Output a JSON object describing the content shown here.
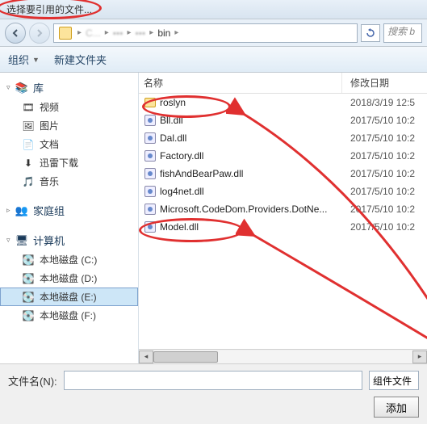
{
  "window": {
    "title": "选择要引用的文件..."
  },
  "breadcrumb": {
    "items": [
      "C...",
      "",
      "",
      "bin"
    ],
    "current": "bin"
  },
  "search": {
    "placeholder": "搜索 b"
  },
  "toolbar": {
    "organize": "组织",
    "newfolder": "新建文件夹"
  },
  "sidebar": {
    "library": {
      "label": "库",
      "items": [
        {
          "label": "视频",
          "icon": "video"
        },
        {
          "label": "图片",
          "icon": "picture"
        },
        {
          "label": "文档",
          "icon": "document"
        },
        {
          "label": "迅雷下载",
          "icon": "download"
        },
        {
          "label": "音乐",
          "icon": "music"
        }
      ]
    },
    "homegroup": {
      "label": "家庭组"
    },
    "computer": {
      "label": "计算机",
      "items": [
        {
          "label": "本地磁盘 (C:)"
        },
        {
          "label": "本地磁盘 (D:)"
        },
        {
          "label": "本地磁盘 (E:)",
          "selected": true
        },
        {
          "label": "本地磁盘 (F:)"
        }
      ]
    }
  },
  "columns": {
    "name": "名称",
    "date": "修改日期"
  },
  "files": [
    {
      "name": "roslyn",
      "type": "folder",
      "date": "2018/3/19 12:5"
    },
    {
      "name": "Bll.dll",
      "type": "dll",
      "date": "2017/5/10 10:2"
    },
    {
      "name": "Dal.dll",
      "type": "dll",
      "date": "2017/5/10 10:2"
    },
    {
      "name": "Factory.dll",
      "type": "dll",
      "date": "2017/5/10 10:2"
    },
    {
      "name": "fishAndBearPaw.dll",
      "type": "dll",
      "date": "2017/5/10 10:2"
    },
    {
      "name": "log4net.dll",
      "type": "dll",
      "date": "2017/5/10 10:2"
    },
    {
      "name": "Microsoft.CodeDom.Providers.DotNe...",
      "type": "dll",
      "date": "2017/5/10 10:2"
    },
    {
      "name": "Model.dll",
      "type": "dll",
      "date": "2017/5/10 10:2"
    }
  ],
  "bottom": {
    "filename_label": "文件名(N):",
    "filter": "组件文件",
    "add_btn": "添加"
  }
}
